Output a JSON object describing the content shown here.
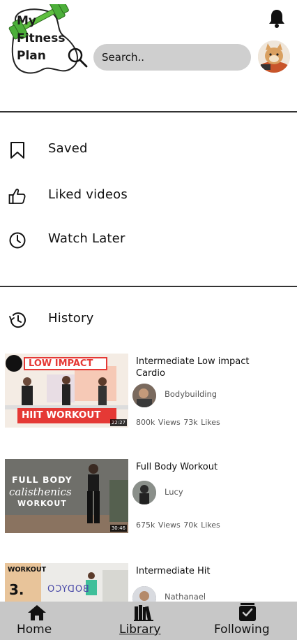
{
  "app": {
    "logo_lines": [
      "My",
      "Fitness",
      "Plan"
    ]
  },
  "header": {
    "search_placeholder": "Search..",
    "icons": {
      "notification": "bell-icon",
      "search": "search-icon",
      "profile": "avatar"
    }
  },
  "menu": {
    "saved": "Saved",
    "liked": "Liked videos",
    "watch_later": "Watch Later",
    "history": "History"
  },
  "videos": [
    {
      "title": "Intermediate Low impact Cardio",
      "channel": "Bodybuilding",
      "views": "800k Views",
      "likes": "73k Likes",
      "thumb_text_top": "LOW IMPACT",
      "thumb_text_bottom": "HIIT WORKOUT",
      "duration": "22:27"
    },
    {
      "title": "Full Body Workout",
      "channel": "Lucy",
      "views": "675k Views",
      "likes": "70k Likes",
      "thumb_text_lines": [
        "FULL BODY",
        "calisthenics",
        "WORKOUT"
      ],
      "duration": "30:46"
    },
    {
      "title": "Intermediate Hit",
      "channel": "Nathanael",
      "thumb_text_top": "WORKOUT",
      "thumb_text_num": "3.",
      "thumb_text_brand": "BODYCO"
    }
  ],
  "bottom_nav": {
    "home": "Home",
    "library": "Library",
    "following": "Following",
    "active": "library"
  },
  "colors": {
    "logo_green": "#4caf3a",
    "search_bg": "#cfcfcf",
    "nav_bg": "#c7c7c7",
    "thumb_red": "#e53935"
  }
}
